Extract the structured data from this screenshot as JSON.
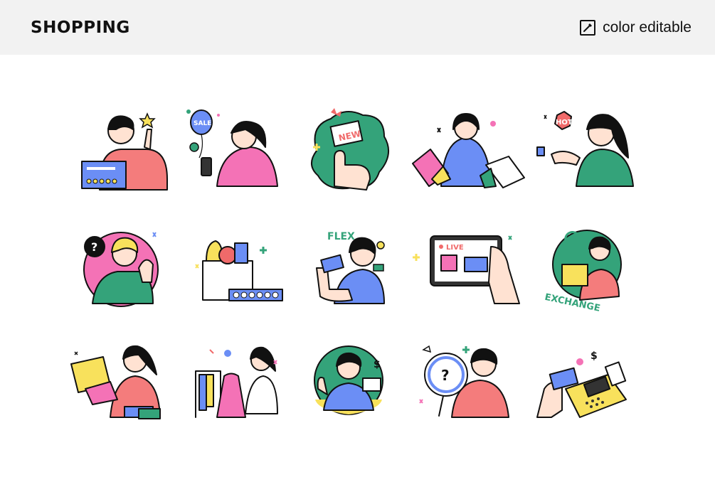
{
  "header": {
    "title": "SHOPPING",
    "badge_label": "color editable",
    "badge_icon": "eyedropper-icon"
  },
  "illustrations": [
    {
      "name": "rating-review",
      "label": ""
    },
    {
      "name": "sale-balloon-phone",
      "label": "SALE"
    },
    {
      "name": "new-tag-hand",
      "label": "NEW"
    },
    {
      "name": "shopping-bags-girl",
      "label": ""
    },
    {
      "name": "hot-deal",
      "label": "HOT"
    },
    {
      "name": "customer-support",
      "label": ""
    },
    {
      "name": "grocery-bag",
      "label": ""
    },
    {
      "name": "flex-card",
      "label": "FLEX"
    },
    {
      "name": "live-shopping-tablet",
      "label": "LIVE"
    },
    {
      "name": "exchange-box",
      "label": "EXCHANGE"
    },
    {
      "name": "girl-yellow-bag",
      "label": ""
    },
    {
      "name": "clothes-rack",
      "label": ""
    },
    {
      "name": "cashier",
      "label": "$"
    },
    {
      "name": "search-question",
      "label": ""
    },
    {
      "name": "card-payment-terminal",
      "label": "$"
    }
  ],
  "colors": {
    "header_bg": "#f2f2f2",
    "pink": "#f472b6",
    "green": "#34a37a",
    "blue": "#6b8ef5",
    "yellow": "#f8e15c",
    "red": "#f06a6a"
  }
}
